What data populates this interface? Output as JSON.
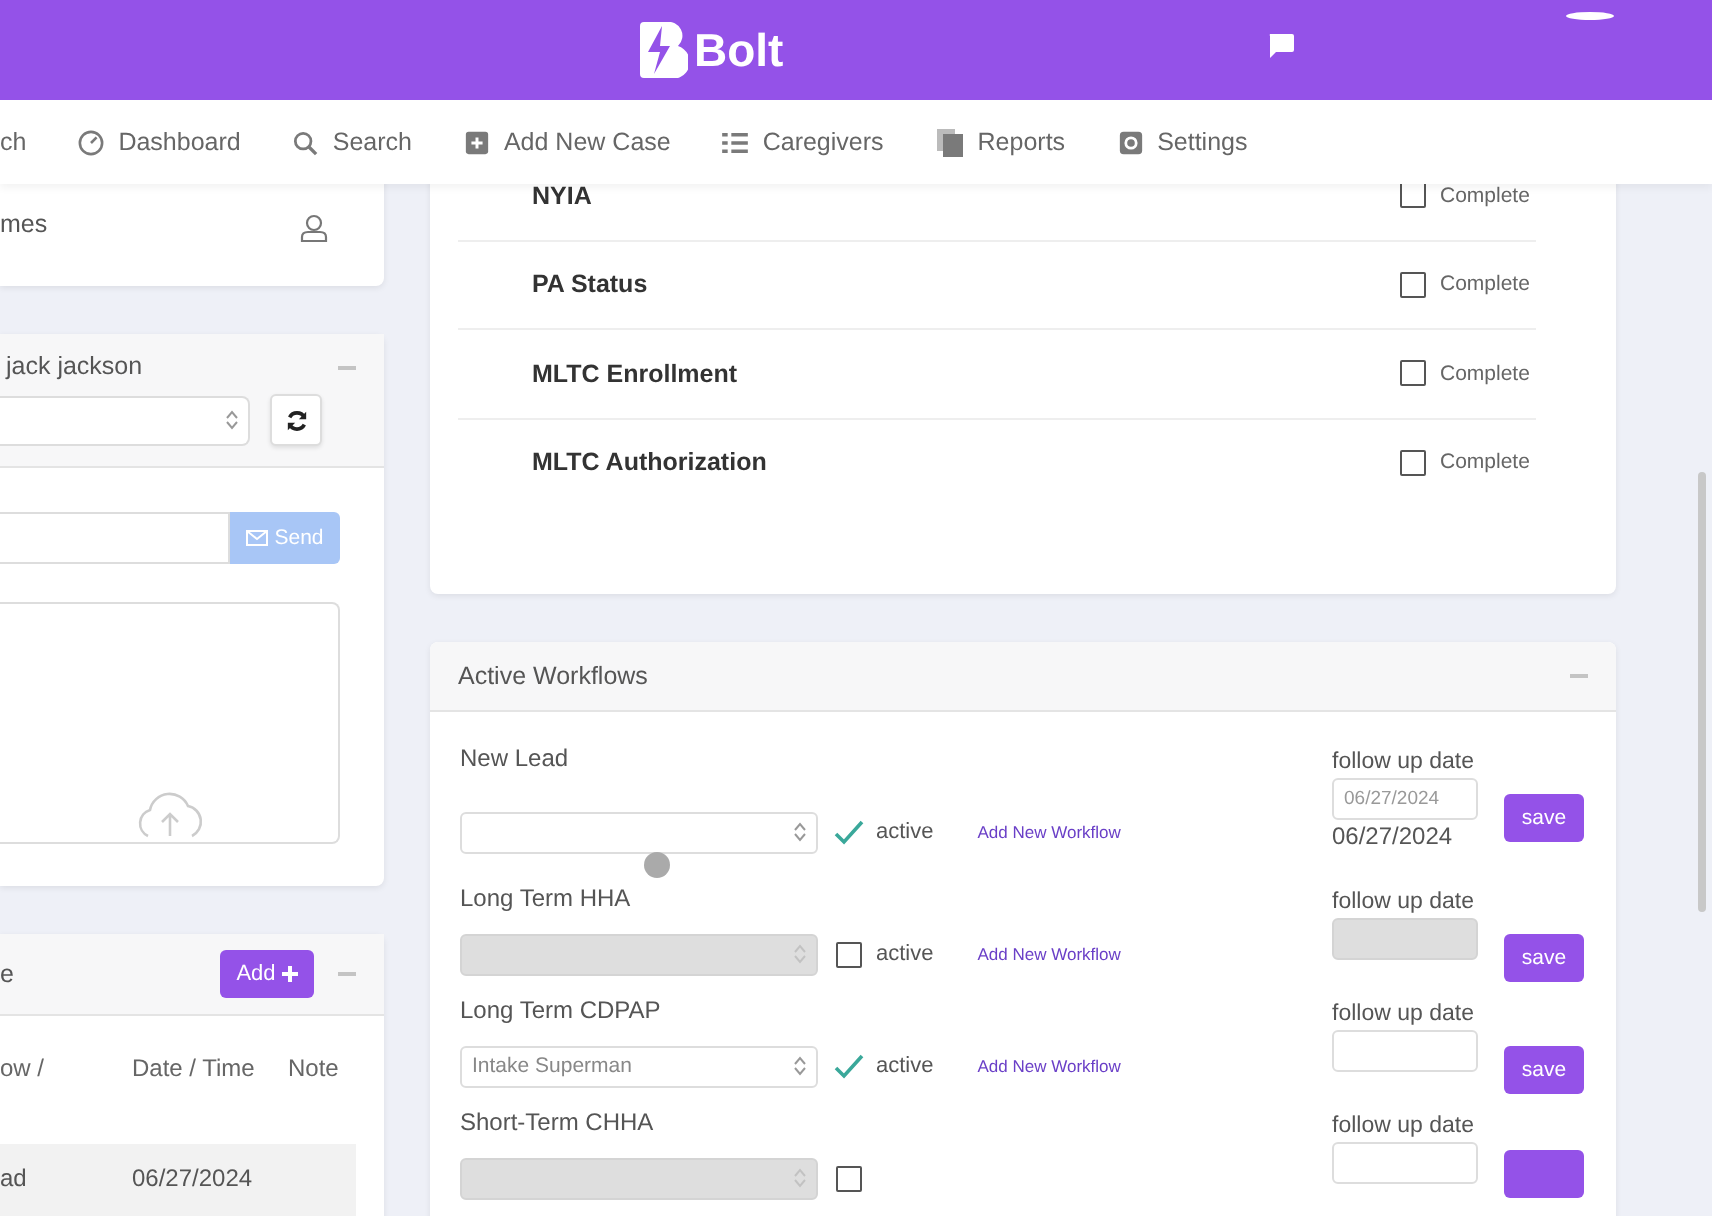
{
  "header": {
    "brand": "Bolt"
  },
  "nav": [
    {
      "label": "ch",
      "kind": "plain"
    },
    {
      "label": "Dashboard",
      "kind": "gauge"
    },
    {
      "label": "Search",
      "kind": "search"
    },
    {
      "label": "Add New Case",
      "kind": "add"
    },
    {
      "label": "Caregivers",
      "kind": "list"
    },
    {
      "label": "Reports",
      "kind": "docs"
    },
    {
      "label": "Settings",
      "kind": "gear"
    }
  ],
  "left": {
    "profile": {
      "text": "mes"
    },
    "messages": {
      "title": "jack jackson",
      "send": "Send"
    },
    "table_panel": {
      "title": "e",
      "add": "Add",
      "columns": [
        "ow /",
        "Date / Time",
        "Note"
      ],
      "rows": [
        {
          "column_1": "ad",
          "date": "06/27/2024"
        }
      ]
    }
  },
  "checklist": [
    {
      "label": "NYIA",
      "checked": false,
      "status": "Complete"
    },
    {
      "label": "PA Status",
      "checked": false,
      "status": "Complete"
    },
    {
      "label": "MLTC Enrollment",
      "checked": false,
      "status": "Complete"
    },
    {
      "label": "MLTC Authorization",
      "checked": false,
      "status": "Complete"
    }
  ],
  "workflows": {
    "title": "Active Workflows",
    "rows": [
      {
        "label": "New Lead",
        "select_value": "",
        "disabled": false,
        "active": true,
        "active_label": "active",
        "link": "Add New Workflow",
        "follow_up_label": "follow up date",
        "date_value": "06/27/2024",
        "date_disabled": false,
        "date_text": "06/27/2024",
        "save": "save"
      },
      {
        "label": "Long Term HHA",
        "select_value": "",
        "disabled": true,
        "active": false,
        "active_label": "active",
        "link": "Add New Workflow",
        "follow_up_label": "follow up date",
        "date_value": "",
        "date_disabled": true,
        "save": "save"
      },
      {
        "label": "Long Term CDPAP",
        "select_value": "Intake Superman",
        "disabled": false,
        "active": true,
        "active_label": "active",
        "link": "Add New Workflow",
        "follow_up_label": "follow up date",
        "date_value": "",
        "date_disabled": false,
        "save": "save"
      },
      {
        "label": "Short-Term CHHA",
        "select_value": "",
        "disabled": true,
        "active": false,
        "follow_up_label": "follow up date",
        "date_disabled": false
      }
    ]
  }
}
